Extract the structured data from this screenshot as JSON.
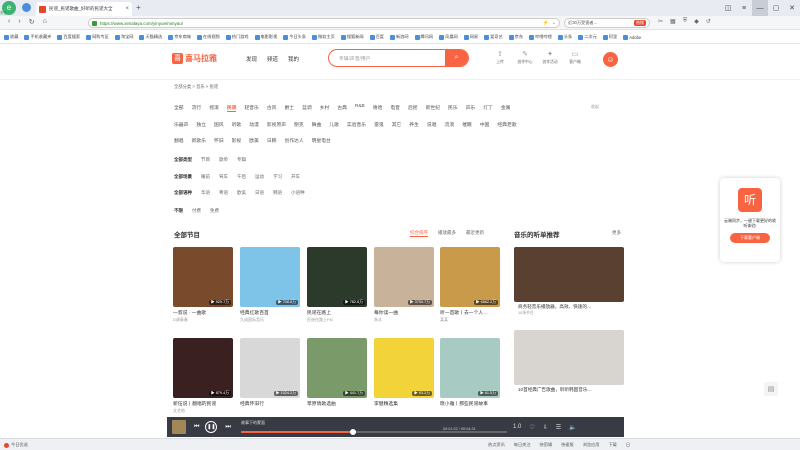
{
  "browser": {
    "brand_label": "安全",
    "tab_title": "民谣_民谣歌曲_好听的民谣大全",
    "url": "https://www.ximalaya.com/yinyue/minyao/",
    "search_text": "近30万受害者...",
    "search_badge": "热搜"
  },
  "bookmarks": [
    "收藏",
    "手机收藏夹",
    "百度搜索",
    "网购专区",
    "淘宝网",
    "天猫精选",
    "京东商城",
    "在线视频",
    "热门游戏",
    "电影影视",
    "今日头条",
    "微软主页",
    "搜狐新闻",
    "百度",
    "新浪网",
    "腾讯网",
    "凤凰网",
    "网易",
    "爱奇艺",
    "京东",
    "哔哩哔哩",
    "头条",
    "二次元",
    "阿里",
    "Adobe"
  ],
  "site": {
    "logo_text": "喜马拉雅",
    "nav": [
      "发现",
      "频道",
      "我的"
    ],
    "search_placeholder": "专辑/声音/用户",
    "header_icons": [
      "上传",
      "创作中心",
      "创作活动",
      "客户端"
    ]
  },
  "breadcrumb": "全部分类 > 音乐 > 民谣",
  "categories": {
    "row1": [
      "全部",
      "流行",
      "摇滚",
      "民谣",
      "轻音乐",
      "古风",
      "爵士",
      "蓝调",
      "乡村",
      "古典",
      "R&B",
      "嘻哈",
      "电音",
      "后摇",
      "新世纪",
      "民乐",
      "声乐",
      "灯丁",
      "金属"
    ],
    "row2": [
      "乐器声",
      "独立",
      "国风",
      "听歌",
      "动漫",
      "影视原声",
      "朋克",
      "舞曲",
      "儿歌",
      "实验音乐",
      "雷鬼",
      "其它",
      "养生",
      "说唱",
      "流浪",
      "催眠",
      "中国",
      "经典老歌"
    ],
    "row3": [
      "翻唱",
      "新歌乐",
      "怀旧",
      "影视",
      "欧美",
      "日韩",
      "创作达人",
      "明星电台"
    ],
    "fold": "收起",
    "selected": "民谣"
  },
  "filters": [
    {
      "label": "全部类型",
      "options": [
        "节目",
        "歌单",
        "专辑"
      ]
    },
    {
      "label": "全部场景",
      "options": [
        "睡前",
        "驾车",
        "午后",
        "运动",
        "学习",
        "开车"
      ]
    },
    {
      "label": "全部语种",
      "options": [
        "华语",
        "粤语",
        "欧美",
        "日语",
        "韩语",
        "小语种"
      ]
    },
    {
      "label": "不限",
      "options": [
        "付费",
        "免费"
      ]
    }
  ],
  "section": {
    "title": "全部节目",
    "sorts": [
      "综合排序",
      "播放最多",
      "最近更新"
    ],
    "active_sort": "综合排序"
  },
  "programs": [
    {
      "title": "一叔说 · 一曲歌",
      "sub": "D调青春",
      "plays": "925.7万",
      "color": "#7a4a2c"
    },
    {
      "title": "经典红歌百首",
      "sub": "九成国际音乐",
      "plays": "708.8万",
      "color": "#7ec3e8"
    },
    {
      "title": "民谣在路上",
      "sub": "民谣在路上FM",
      "plays": "782.8万",
      "color": "#2b3a2b"
    },
    {
      "title": "每你读一曲",
      "sub": "朱丰",
      "plays": "3750.7万",
      "color": "#c8b29a"
    },
    {
      "title": "听一首歌丨去一个人…",
      "sub": "某某",
      "plays": "6862.2万",
      "color": "#c99a4a"
    },
    {
      "title": "新伍说丨翻唱的民谣",
      "sub": "文艺地",
      "plays": "879.4万",
      "color": "#3a2020"
    },
    {
      "title": "经典怀旧行",
      "sub": "",
      "plays": "1024.2万",
      "color": "#d8d8d8"
    },
    {
      "title": "草原情歌选曲",
      "sub": "",
      "plays": "441.7万",
      "color": "#7a9a6a"
    },
    {
      "title": "李健精选集",
      "sub": "",
      "plays": "93.2万",
      "color": "#f2d33a"
    },
    {
      "title": "晓小雅丨那些民谣故事",
      "sub": "",
      "plays": "61.5万",
      "color": "#a7cbc2"
    }
  ],
  "recommend": {
    "title": "音乐的听单推荐",
    "more": "更多",
    "items": [
      {
        "title": "商务轻音乐播放器，高效、快速的…",
        "sub": "10场节目",
        "color": "#5a4030"
      },
      {
        "title": "10首经典广告歌曲，聆听韩国音乐…",
        "sub": "",
        "color": "#d8d4d0"
      }
    ]
  },
  "widget": {
    "text": "云端同步，一键下载更好的收听体验!",
    "button": "下载客户端"
  },
  "player": {
    "title": "故事下的蒙面",
    "time": "00:01:22 / 00:04:31",
    "progress": 0.3
  },
  "status_bar": {
    "left": "今日优选",
    "right": [
      "热点资讯",
      "每日关注",
      "快剪辑",
      "快速报",
      "浏览应用",
      "下载",
      "日"
    ]
  }
}
